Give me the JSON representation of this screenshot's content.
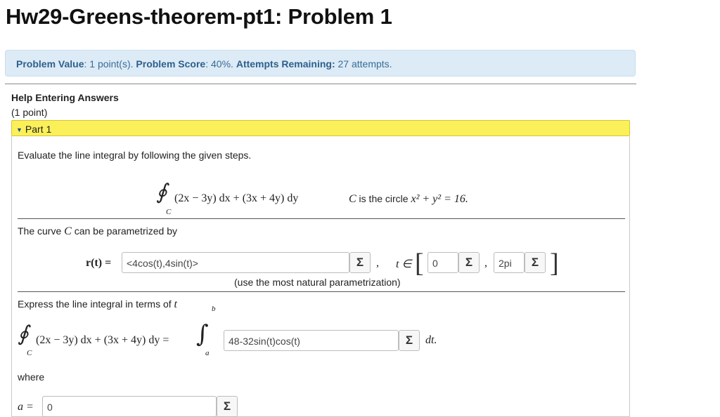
{
  "page": {
    "title": "Hw29-Greens-theorem-pt1: Problem 1"
  },
  "info": {
    "value_label": "Problem Value",
    "value_text": ": 1 point(s). ",
    "score_label": "Problem Score",
    "score_text": ": 40%. ",
    "attempts_label": "Attempts Remaining:",
    "attempts_text": " 27 attempts."
  },
  "help": {
    "link": "Help Entering Answers",
    "points": "(1 point)"
  },
  "part": {
    "label": "Part 1"
  },
  "problem": {
    "instruction": "Evaluate the line integral by following the given steps.",
    "integrand": "(2x − 3y) dx + (3x + 4y) dy",
    "curve_sub": "C",
    "curve_label": "C",
    "curve_desc": " is the circle ",
    "circle_eq": "x² + y² = 16.",
    "param_text_a": "The curve ",
    "param_text_c": "C",
    "param_text_b": " can be parametrized by",
    "r_label": "r(t) =",
    "r_value": "<4cos(t),4sin(t)>",
    "t_label": "t ∈",
    "t_start": "0",
    "t_end": "2pi",
    "comma": ",",
    "hint": "(use the most natural parametrization)",
    "express_text": "Express the line integral in terms of",
    "express_var": "t",
    "lhs": "(2x − 3y) dx + (3x + 4y) dy =",
    "upper": "b",
    "lower": "a",
    "integral_value": "48-32sin(t)cos(t)",
    "dt": "dt.",
    "where": "where",
    "a_label": "a =",
    "a_value": "0"
  },
  "icons": {
    "sigma": "Σ",
    "integral": "∫",
    "contour": "∮",
    "triangle": "▼"
  }
}
